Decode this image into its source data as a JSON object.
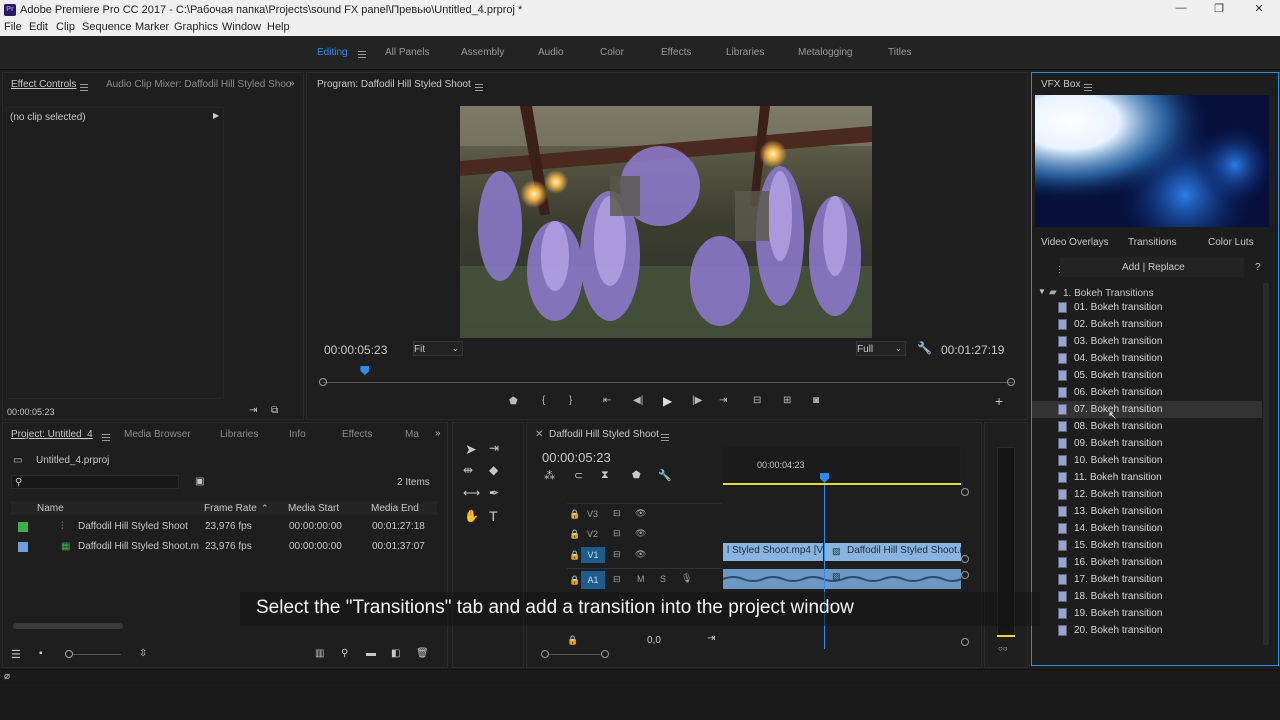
{
  "window": {
    "title": "Adobe Premiere Pro CC 2017 - C:\\Рабочая папка\\Projects\\sound FX panel\\Превью\\Untitled_4.prproj *",
    "app_icon": "Pr",
    "controls": [
      "—",
      "❐",
      "✕"
    ]
  },
  "menu": [
    "File",
    "Edit",
    "Clip",
    "Sequence",
    "Marker",
    "Graphics",
    "Window",
    "Help"
  ],
  "workspaces": {
    "active": "Editing",
    "items": [
      "Editing",
      "All Panels",
      "Assembly",
      "Audio",
      "Color",
      "Effects",
      "Libraries",
      "Metalogging",
      "Titles"
    ]
  },
  "effect_controls": {
    "tab_active": "Effect Controls",
    "tab_other": "Audio Clip Mixer: Daffodil Hill Styled Shoo",
    "no_clip": "(no clip selected)",
    "timecode": "00:00:05:23"
  },
  "program": {
    "title": "Program: Daffodil Hill Styled Shoot",
    "timecode": "00:00:05:23",
    "fit": "Fit",
    "quality": "Full",
    "duration": "00:01:27:19",
    "playhead_fraction": 0.06
  },
  "project": {
    "tabs": [
      "Project: Untitled_4",
      "Media Browser",
      "Libraries",
      "Info",
      "Effects",
      "Ma"
    ],
    "file": "Untitled_4.prproj",
    "items_count": "2 Items",
    "columns": [
      "Name",
      "Frame Rate",
      "Media Start",
      "Media End"
    ],
    "rows": [
      {
        "color": "#3fae49",
        "name": "Daffodil Hill Styled Shoot",
        "fps": "23,976 fps",
        "start": "00:00:00:00",
        "end": "00:01:27:18"
      },
      {
        "color": "#6f9fe0",
        "name": "Daffodil Hill Styled Shoot.m",
        "fps": "23,976 fps",
        "start": "00:00:00:00",
        "end": "00:01:37:07"
      }
    ]
  },
  "timeline": {
    "title": "Daffodil Hill Styled Shoot",
    "timecode": "00:00:05:23",
    "ruler_time": "00:00:04:23",
    "tracks": [
      "V3",
      "V2",
      "V1",
      "A1"
    ],
    "track_buttons": {
      "mute": "M",
      "solo": "S"
    },
    "clip_v1_left": "l Styled Shoot.mp4 [V]",
    "clip_v1_right": "Daffodil Hill Styled Shoot.m",
    "volume": "0,0"
  },
  "vfx": {
    "title": "VFX Box",
    "tabs": [
      "Video Overlays",
      "Transitions",
      "Color Luts"
    ],
    "action": "Add | Replace",
    "help": "?",
    "folder": "1. Bokeh Transitions",
    "items": [
      "01. Bokeh transition",
      "02. Bokeh transition",
      "03. Bokeh transition",
      "04. Bokeh transition",
      "05. Bokeh transition",
      "06. Bokeh transition",
      "07. Bokeh transition",
      "08. Bokeh transition",
      "09. Bokeh transition",
      "10. Bokeh transition",
      "11. Bokeh transition",
      "12. Bokeh transition",
      "13. Bokeh transition",
      "14. Bokeh transition",
      "15. Bokeh transition",
      "16. Bokeh transition",
      "17. Bokeh transition",
      "18. Bokeh transition",
      "19. Bokeh transition",
      "20. Bokeh transition"
    ],
    "highlighted_index": 6
  },
  "caption": "Select the \"Transitions\" tab and add a transition into the project window",
  "colors": {
    "accent": "#2d8ceb",
    "panel": "#1e1e1e",
    "clip_video": "#8ab4e0",
    "work_area": "#e8d83a"
  }
}
